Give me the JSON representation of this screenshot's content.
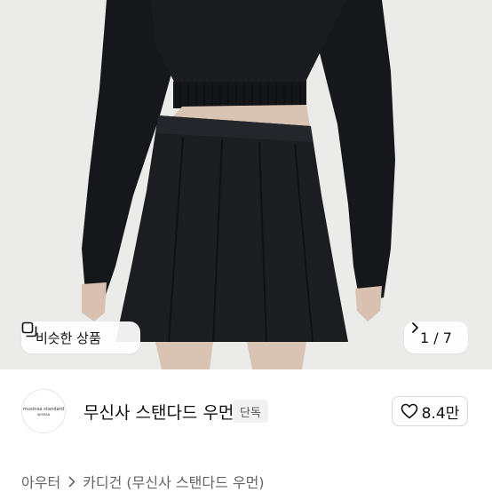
{
  "gallery": {
    "similar_button_label": "비슷한 상품",
    "pager_text": "1 / 7",
    "icons": {
      "similar": "similar-items-icon",
      "next": "chevron-right-icon"
    }
  },
  "brand": {
    "logo_line1": "musinsa standard",
    "logo_line2": "WOMAN",
    "name": "무신사 스탠다드 우먼",
    "exclusive_badge": "단독",
    "like_count": "8.4만",
    "like_icon": "heart-outline-icon"
  },
  "breadcrumb": {
    "items": [
      "아우터",
      "카디건 (무신사 스탠다드 우먼)"
    ],
    "separator_icon": "chevron-right-icon"
  },
  "colors": {
    "background": "#ffffff",
    "text_primary": "#111111",
    "text_secondary": "#666666",
    "chip_background": "#ffffff",
    "badge_background": "#f2f2f2"
  }
}
